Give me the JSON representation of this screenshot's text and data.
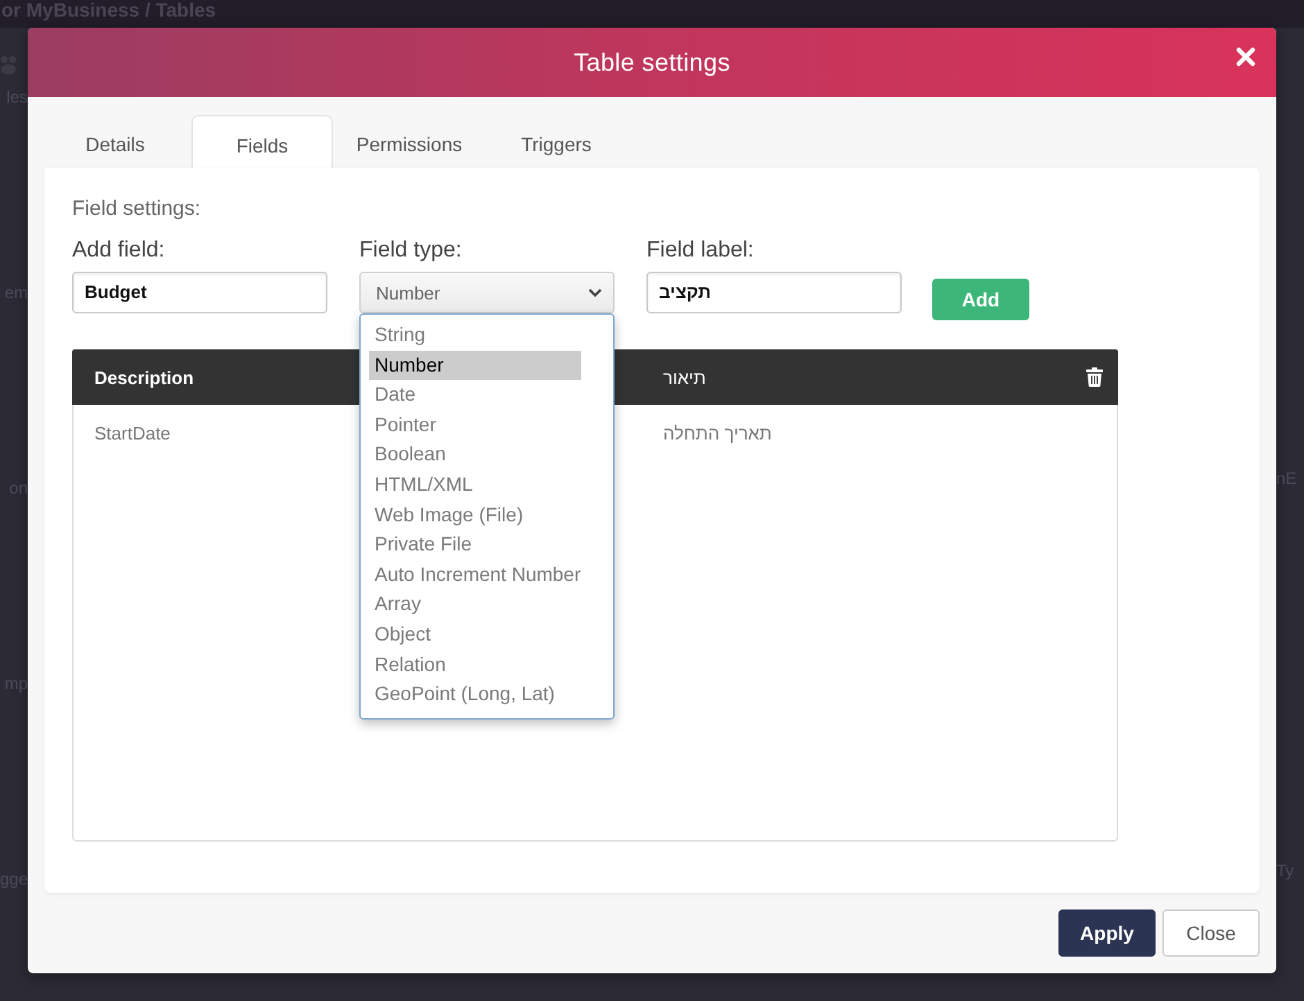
{
  "backdrop": {
    "breadcrumb": "or MyBusiness / Tables",
    "left_fragments": [
      "les",
      "em",
      "on",
      "mp",
      "gge"
    ],
    "right_fragments": [
      "nE",
      "Ty"
    ]
  },
  "dialog": {
    "title": "Table settings",
    "tabs": [
      {
        "label": "Details",
        "selected": false
      },
      {
        "label": "Fields",
        "selected": true
      },
      {
        "label": "Permissions",
        "selected": false
      },
      {
        "label": "Triggers",
        "selected": false
      }
    ],
    "form": {
      "heading": "Field settings:",
      "fields": [
        {
          "kind": "text",
          "label": "Add field:",
          "value": "Budget"
        },
        {
          "kind": "select",
          "label": "Field type:",
          "value": "Number",
          "expanded": true,
          "options": [
            {
              "label": "String",
              "selected": false
            },
            {
              "label": "Number",
              "selected": true
            },
            {
              "label": "Date",
              "selected": false
            },
            {
              "label": "Pointer",
              "selected": false
            },
            {
              "label": "Boolean",
              "selected": false
            },
            {
              "label": "HTML/XML",
              "selected": false
            },
            {
              "label": "Web Image (File)",
              "selected": false
            },
            {
              "label": "Private File",
              "selected": false
            },
            {
              "label": "Auto Increment Number",
              "selected": false
            },
            {
              "label": "Array",
              "selected": false
            },
            {
              "label": "Object",
              "selected": false
            },
            {
              "label": "Relation",
              "selected": false
            },
            {
              "label": "GeoPoint (Long, Lat)",
              "selected": false
            }
          ]
        },
        {
          "kind": "text",
          "label": "Field label:",
          "value": "תקציב"
        }
      ],
      "add_button": "Add"
    },
    "table": {
      "columns": [
        "Description",
        "תיאור"
      ],
      "rows": [
        [
          "StartDate",
          "תאריך התחלה"
        ]
      ]
    },
    "buttons": [
      {
        "label": "Apply",
        "kind": "primary"
      },
      {
        "label": "Close",
        "kind": "secondary"
      }
    ]
  }
}
